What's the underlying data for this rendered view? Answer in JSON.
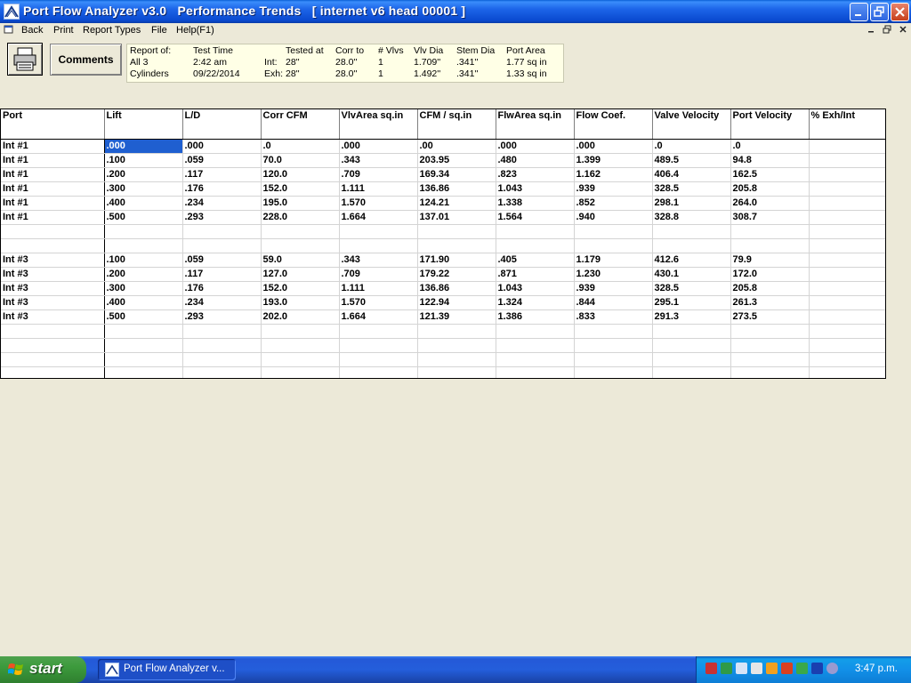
{
  "window": {
    "title": "Port Flow Analyzer v3.0   Performance Trends   [ internet v6 head 00001 ]"
  },
  "menu": {
    "items": [
      "Back",
      "Print",
      "Report Types",
      "File",
      "Help(F1)"
    ]
  },
  "toolbar": {
    "comments_label": "Comments"
  },
  "info": {
    "report_of_label": "Report of:",
    "report_of_value1": "All 3",
    "report_of_value2": "Cylinders",
    "test_time_label": "Test Time",
    "test_time": "2:42 am",
    "test_date": "09/22/2014",
    "tested_at_label": "Tested at",
    "int_label": "Int:",
    "exh_label": "Exh:",
    "int_tested": "28''",
    "exh_tested": "28''",
    "corr_to_label": "Corr to",
    "int_corr": "28.0''",
    "exh_corr": "28.0''",
    "vlvs_label": "# Vlvs",
    "int_vlvs": "1",
    "exh_vlvs": "1",
    "vlv_dia_label": "Vlv Dia",
    "int_vlv_dia": "1.709''",
    "exh_vlv_dia": "1.492''",
    "stem_dia_label": "Stem Dia",
    "int_stem_dia": ".341''",
    "exh_stem_dia": ".341''",
    "port_area_label": "Port Area",
    "int_port_area": "1.77 sq in",
    "exh_port_area": "1.33 sq in"
  },
  "grid": {
    "headers": [
      "Port",
      "Lift",
      "L/D",
      "Corr CFM",
      "VlvArea sq.in",
      "CFM / sq.in",
      "FlwArea sq.in",
      "Flow Coef.",
      "Valve Velocity",
      "Port Velocity",
      "% Exh/Int"
    ],
    "rows": [
      [
        "Int #1",
        ".000",
        ".000",
        ".0",
        ".000",
        ".00",
        ".000",
        ".000",
        ".0",
        ".0",
        ""
      ],
      [
        "Int #1",
        ".100",
        ".059",
        "70.0",
        ".343",
        "203.95",
        ".480",
        "1.399",
        "489.5",
        "94.8",
        ""
      ],
      [
        "Int #1",
        ".200",
        ".117",
        "120.0",
        ".709",
        "169.34",
        ".823",
        "1.162",
        "406.4",
        "162.5",
        ""
      ],
      [
        "Int #1",
        ".300",
        ".176",
        "152.0",
        "1.111",
        "136.86",
        "1.043",
        ".939",
        "328.5",
        "205.8",
        ""
      ],
      [
        "Int #1",
        ".400",
        ".234",
        "195.0",
        "1.570",
        "124.21",
        "1.338",
        ".852",
        "298.1",
        "264.0",
        ""
      ],
      [
        "Int #1",
        ".500",
        ".293",
        "228.0",
        "1.664",
        "137.01",
        "1.564",
        ".940",
        "328.8",
        "308.7",
        ""
      ],
      [
        "",
        "",
        "",
        "",
        "",
        "",
        "",
        "",
        "",
        "",
        ""
      ],
      [
        "",
        "",
        "",
        "",
        "",
        "",
        "",
        "",
        "",
        "",
        ""
      ],
      [
        "Int #3",
        ".100",
        ".059",
        "59.0",
        ".343",
        "171.90",
        ".405",
        "1.179",
        "412.6",
        "79.9",
        ""
      ],
      [
        "Int #3",
        ".200",
        ".117",
        "127.0",
        ".709",
        "179.22",
        ".871",
        "1.230",
        "430.1",
        "172.0",
        ""
      ],
      [
        "Int #3",
        ".300",
        ".176",
        "152.0",
        "1.111",
        "136.86",
        "1.043",
        ".939",
        "328.5",
        "205.8",
        ""
      ],
      [
        "Int #3",
        ".400",
        ".234",
        "193.0",
        "1.570",
        "122.94",
        "1.324",
        ".844",
        "295.1",
        "261.3",
        ""
      ],
      [
        "Int #3",
        ".500",
        ".293",
        "202.0",
        "1.664",
        "121.39",
        "1.386",
        ".833",
        "291.3",
        "273.5",
        ""
      ],
      [
        "",
        "",
        "",
        "",
        "",
        "",
        "",
        "",
        "",
        "",
        ""
      ],
      [
        "",
        "",
        "",
        "",
        "",
        "",
        "",
        "",
        "",
        "",
        ""
      ],
      [
        "",
        "",
        "",
        "",
        "",
        "",
        "",
        "",
        "",
        "",
        ""
      ],
      [
        "",
        "",
        "",
        "",
        "",
        "",
        "",
        "",
        "",
        "",
        ""
      ]
    ]
  },
  "taskbar": {
    "start_label": "start",
    "task_label": "Port Flow Analyzer v...",
    "clock": "3:47 p.m."
  },
  "colors": {
    "selection": "#1f5fd0",
    "titlebar": "#0a4ad0",
    "taskbar": "#245edb"
  }
}
